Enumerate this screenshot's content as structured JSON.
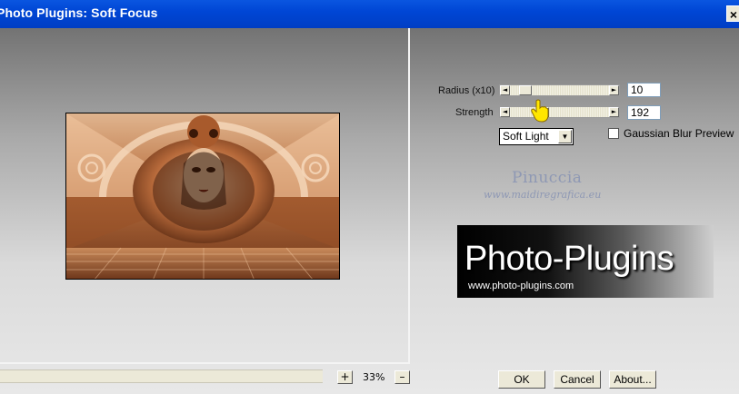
{
  "window": {
    "title": "Photo Plugins: Soft Focus",
    "close_glyph": "×"
  },
  "controls": {
    "radius": {
      "label": "Radius (x10)",
      "value": "10",
      "level": 0.1
    },
    "strength": {
      "label": "Strength",
      "value": "192",
      "level": 0.3
    },
    "blend_mode": {
      "selected": "Soft Light"
    },
    "gaussian_preview": {
      "label": "Gaussian Blur Preview",
      "checked": false
    }
  },
  "watermark": {
    "name": "Pinuccia",
    "url": "www.maidiregrafica.eu"
  },
  "logo": {
    "title": "Photo-Plugins",
    "url": "www.photo-plugins.com"
  },
  "zoom": {
    "plus": "+",
    "minus": "–",
    "level": "33%"
  },
  "buttons": {
    "ok": "OK",
    "cancel": "Cancel",
    "about": "About..."
  },
  "icons": {
    "close": "close-icon",
    "left_arrow": "arrow-left-icon",
    "right_arrow": "arrow-right-icon",
    "dropdown": "chevron-down-icon",
    "cursor": "hand-pointer-icon"
  }
}
